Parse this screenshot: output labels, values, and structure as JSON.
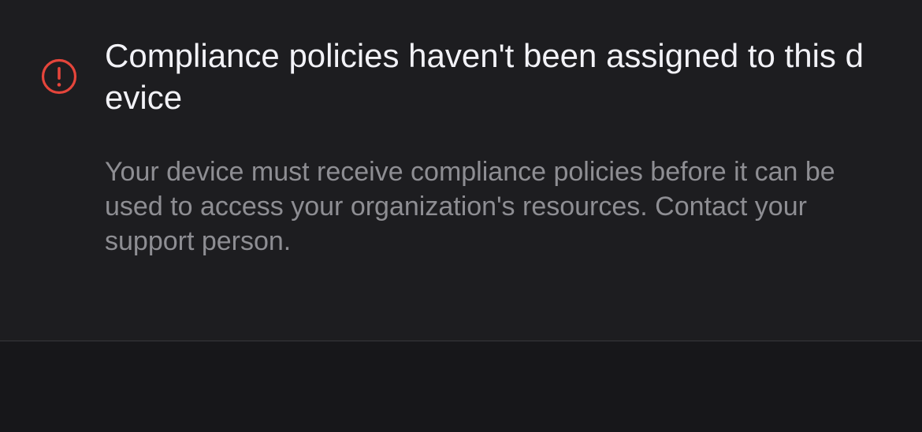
{
  "notice": {
    "icon": "exclamation-circle-icon",
    "icon_color": "#e5453b",
    "title": "Compliance policies haven't been assigned to this device",
    "description": "Your device must receive compliance policies before it can be used to access your organization's resources. Contact your support person."
  }
}
